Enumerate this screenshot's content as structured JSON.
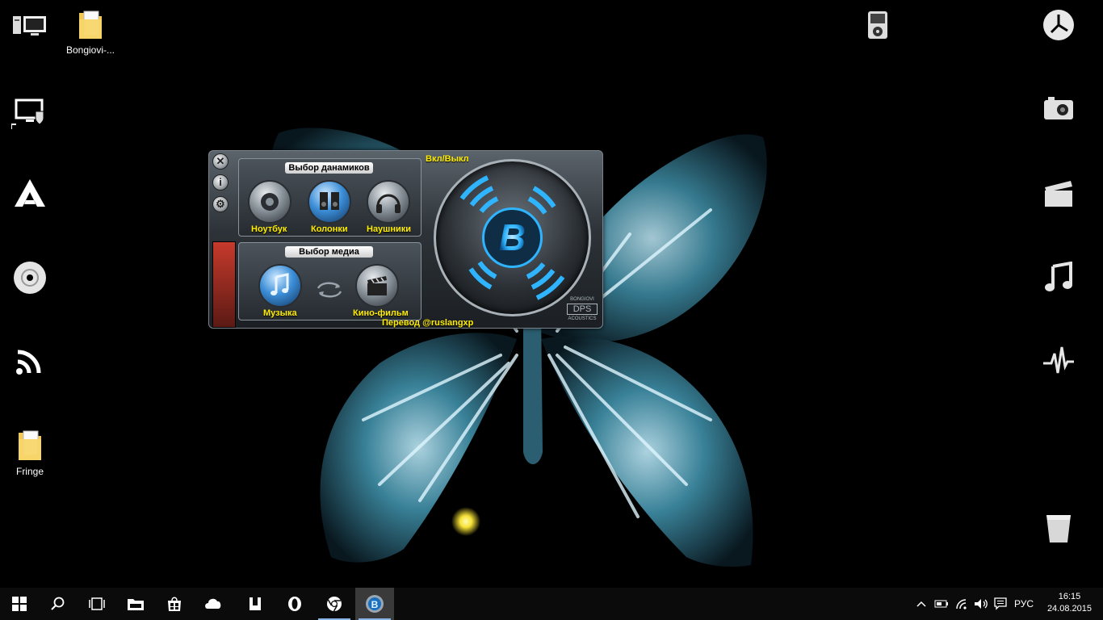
{
  "desktop": {
    "left_icons": [
      {
        "name": "this-pc-icon",
        "label": ""
      },
      {
        "name": "bongiovi-folder-icon",
        "label": "Bongiovi-..."
      },
      {
        "name": "defender-monitor-icon",
        "label": ""
      },
      {
        "name": "aimp-a-icon",
        "label": ""
      },
      {
        "name": "disc-icon",
        "label": ""
      },
      {
        "name": "rss-icon",
        "label": ""
      },
      {
        "name": "fringe-folder-icon",
        "label": "Fringe"
      }
    ],
    "right_icons": [
      {
        "name": "ipod-icon"
      },
      {
        "name": "clock-icon"
      },
      {
        "name": "camera-icon"
      },
      {
        "name": "clapperboard-icon"
      },
      {
        "name": "music-note-icon"
      },
      {
        "name": "pulse-icon"
      },
      {
        "name": "recycle-bin-icon"
      }
    ]
  },
  "widget": {
    "speaker_panel_title": "Выбор данамиков",
    "speakers": [
      "Ноутбук",
      "Колонки",
      "Наушники"
    ],
    "media_panel_title": "Выбор медиа",
    "media": [
      "Музыка",
      "Кино-фильм"
    ],
    "power_label": "Вкл/Выкл",
    "credit": "Перевод @ruslangxp",
    "logo_letter": "B",
    "brand": "BONGIOVI",
    "brand_sub": "DPS",
    "brand_sub2": "ACOUSTICS",
    "side_info": "i"
  },
  "taskbar": {
    "apps": [
      "start-icon",
      "search-icon",
      "task-view-icon",
      "file-explorer-icon",
      "store-icon",
      "app-cloud-icon",
      "utorrent-icon",
      "opera-icon",
      "chrome-icon",
      "bongiovi-taskbar-icon"
    ],
    "language": "РУС",
    "time": "16:15",
    "date": "24.08.2015"
  },
  "colors": {
    "accent_yellow": "#ffee00",
    "glow_blue": "#2fb4ff",
    "taskbar": "#0b0b0b"
  }
}
